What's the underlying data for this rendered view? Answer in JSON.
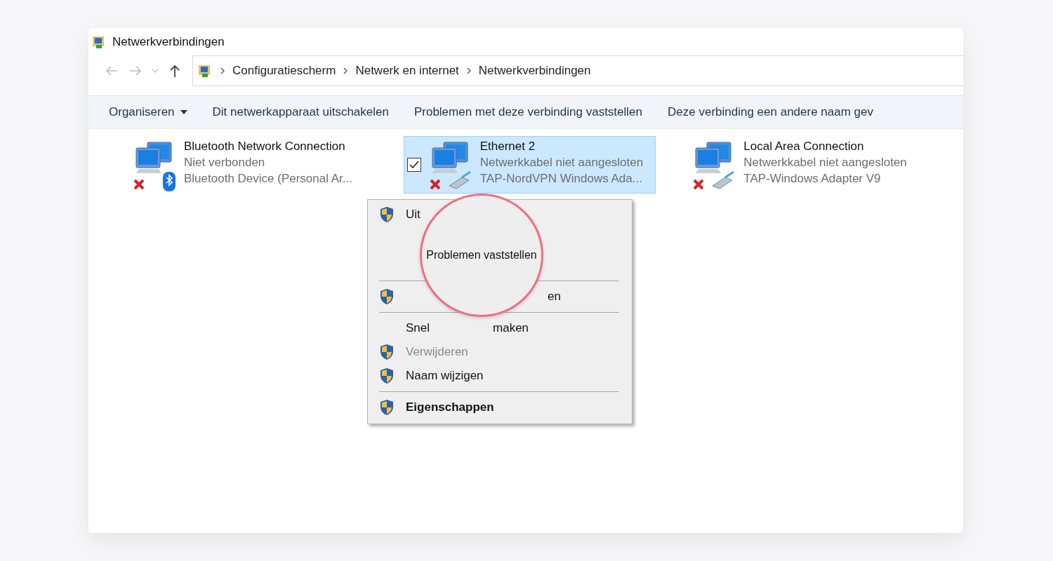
{
  "window": {
    "title": "Netwerkverbindingen"
  },
  "navigation": {
    "back_disabled": true,
    "forward_disabled": true
  },
  "breadcrumbs": [
    "Configuratiescherm",
    "Netwerk en internet",
    "Netwerkverbindingen"
  ],
  "toolbar": [
    {
      "label": "Organiseren",
      "dropdown": true
    },
    {
      "label": "Dit netwerkapparaat uitschakelen",
      "dropdown": false
    },
    {
      "label": "Problemen met deze verbinding vaststellen",
      "dropdown": false
    },
    {
      "label": "Deze verbinding een andere naam gev",
      "dropdown": false
    }
  ],
  "connections": [
    {
      "name": "Bluetooth Network Connection",
      "status": "Niet verbonden",
      "device": "Bluetooth Device (Personal Ar...",
      "kind": "bluetooth",
      "selected": false
    },
    {
      "name": "Ethernet 2",
      "status": "Netwerkkabel niet aangesloten",
      "device": "TAP-NordVPN Windows Ada...",
      "kind": "cable",
      "selected": true
    },
    {
      "name": "Local Area Connection",
      "status": "Netwerkkabel niet aangesloten",
      "device": "TAP-Windows Adapter V9",
      "kind": "cable",
      "selected": false
    }
  ],
  "context_menu": {
    "items": [
      {
        "kind": "item",
        "text": "Uit",
        "shield": true,
        "disabled": false,
        "bold": false
      },
      {
        "kind": "magnified",
        "text": "Problemen vaststellen"
      },
      {
        "kind": "separator"
      },
      {
        "kind": "item",
        "tail": "en",
        "shield": true,
        "disabled": false,
        "bold": false
      },
      {
        "kind": "separator"
      },
      {
        "kind": "item",
        "text": "Snel",
        "tail": "maken",
        "shield": false,
        "disabled": false,
        "bold": false
      },
      {
        "kind": "item",
        "text": "Verwijderen",
        "shield": true,
        "disabled": true,
        "bold": false
      },
      {
        "kind": "item",
        "text": "Naam wijzigen",
        "shield": true,
        "disabled": false,
        "bold": false
      },
      {
        "kind": "separator"
      },
      {
        "kind": "item",
        "text": "Eigenschappen",
        "shield": true,
        "disabled": false,
        "bold": true
      }
    ]
  }
}
